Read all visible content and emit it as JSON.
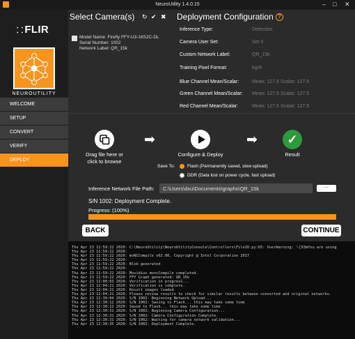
{
  "window": {
    "title": "NeuroUtility 1.4.0.15",
    "minimize": "–",
    "maximize": "□",
    "close": "✕"
  },
  "brand": {
    "logo_text": "FLIR",
    "logo_mark": "⸬",
    "sub": "NEUROUTILITY"
  },
  "nav": [
    {
      "label": "WELCOME",
      "active": false
    },
    {
      "label": "SETUP",
      "active": false
    },
    {
      "label": "CONVERT",
      "active": false
    },
    {
      "label": "VERIFY",
      "active": false
    },
    {
      "label": "DEPLOY",
      "active": true
    }
  ],
  "camera": {
    "title": "Select Camera(s)",
    "refresh_glyph": "↻",
    "check_glyph": "✔",
    "clear_glyph": "✖",
    "model_line": "Model Name:   Firefly FFY-U3-16S2C-DL",
    "serial_line": "Serial Number: 1002",
    "network_line": "Network Label: QR_15k"
  },
  "deploy_config": {
    "title": "Deployment Configuration",
    "help_glyph": "?",
    "rows": [
      {
        "label": "Inference Type:",
        "value": "Detection"
      },
      {
        "label": "Camera User Set:",
        "value": "Set 0"
      },
      {
        "label": "Custom Network Label:",
        "value": "QR_15k"
      },
      {
        "label": "Training Pixel Format:",
        "value": "bgr8"
      },
      {
        "label": "Blue Channel Mean/Scalar:",
        "value": "Mean: 127.5   Scalar: 127.5"
      },
      {
        "label": "Green Channel Mean/Scalar:",
        "value": "Mean: 127.5   Scalar: 127.5"
      },
      {
        "label": "Red Channel Mean/Scalar:",
        "value": "Mean: 127.5   Scalar: 127.5"
      }
    ]
  },
  "steps": {
    "drag": {
      "line1": "Drag file here or",
      "line2": "click to browse"
    },
    "deploy": {
      "label": "Configure & Deploy"
    },
    "result": {
      "label": "Result",
      "glyph": "✓"
    },
    "arrow_glyph": "➡"
  },
  "save": {
    "label": "Save To:",
    "options": [
      {
        "label": "Flash (Permanently saved, slow upload)",
        "selected": true
      },
      {
        "label": "DDR (Data lost on power cycle, fast upload)",
        "selected": false
      }
    ]
  },
  "inference_path": {
    "label": "Inference Network File Path:",
    "value": "C:\\Users\\dxu\\Documents\\graphs\\QR_15k",
    "browse_label": "..."
  },
  "status": "S/N 1002: Deployment Complete.",
  "progress": {
    "label": "Progress: (100%)",
    "value": 1.0,
    "color": "#f7941d"
  },
  "buttons": {
    "back": "BACK",
    "continue": "CONTINUE"
  },
  "accent": "#f7941d",
  "console_lines": [
    "Thu Apr 23 11:59:22 2020: C:\\NeuroUtility\\NeuroUtilityConsole\\Controllers\\FileIO.py:65: UserWarning: ␛[93mYou are using",
    "Thu Apr 23 11:59:22 2020:",
    "Thu Apr 23 11:59:22 2020: mvNCCompile v02.00, Copyright @ Intel Corporation 2017",
    "Thu Apr 23 11:59:22 2020:",
    "Thu Apr 23 11:59:22 2020: Blob generated",
    "Thu Apr 23 11:59:22 2020:",
    "Thu Apr 23 11:59:22 2020: Movidius mvncCompile completed.",
    "Thu Apr 23 11:59:22 2020: FFY Graph generated: QR_15k",
    "Thu Apr 23 12:00:03 2020: Verification in progress...",
    "Thu Apr 23 12:04:21 2020: Verification is complete.",
    "Thu Apr 23 12:04:21 2020: Result images loaded",
    "Thu Apr 23 12:04:21 2020: Please review results to check for similar results between converted and original networks.",
    "Thu Apr 23 12:30:04 2020: S/N 1002: Beginning Network Upload...",
    "Thu Apr 23 12:30:12 2020: S/N 1002: Saving to Flash... this may take some time",
    "Thu Apr 23 12:30:12 2020: Saved to Flash... this may take some time",
    "Thu Apr 23 12:30:31 2020: S/N 1002: Beginning Camera Configuration...",
    "Thu Apr 23 12:30:31 2020: S/N 1002: Camera Configuration Complete.",
    "Thu Apr 23 12:30:31 2020: S/N 1002: Waiting for camera network validation...",
    "Thu Apr 23 12:30:35 2020: S/N 1002: Deployment Complete."
  ]
}
